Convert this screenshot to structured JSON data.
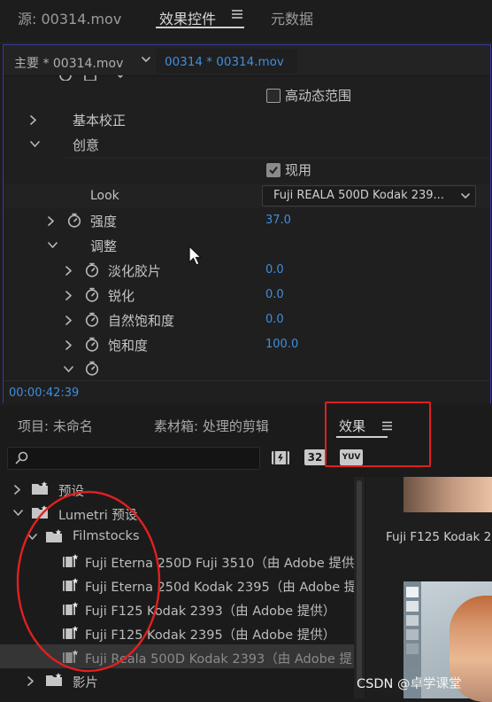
{
  "top_tabs": {
    "source": "源: 00314.mov",
    "effect_controls": "效果控件",
    "metadata": "元数据"
  },
  "sequence_tabs": {
    "master": "主要 * 00314.mov",
    "clip": "00314 * 00314.mov"
  },
  "effect_controls": {
    "hdr_label": "高动态范围",
    "basic_correction": "基本校正",
    "creative": "创意",
    "enable_label": "现用",
    "look_label": "Look",
    "look_value": "Fuji REALA 500D Kodak 239...",
    "intensity_label": "强度",
    "intensity_value": "37.0",
    "adjust_label": "调整",
    "params": [
      {
        "label": "淡化胶片",
        "value": "0.0"
      },
      {
        "label": "锐化",
        "value": "0.0"
      },
      {
        "label": "自然饱和度",
        "value": "0.0"
      },
      {
        "label": "饱和度",
        "value": "100.0"
      }
    ],
    "timecode": "00:00:42:39"
  },
  "bottom_tabs": {
    "project": "项目: 未命名",
    "bin": "素材箱: 处理的剪辑",
    "effects": "效果"
  },
  "toolbar": {
    "badge_32": "32",
    "badge_yuv": "YUV"
  },
  "effects_tree": {
    "presets": "预设",
    "lumetri": "Lumetri 预设",
    "filmstocks": "Filmstocks",
    "items": [
      "Fuji Eterna 250D Fuji 3510（由 Adobe 提供",
      "Fuji Eterna 250d Kodak 2395（由 Adobe 提",
      "Fuji F125 Kodak 2393（由 Adobe 提供）",
      "Fuji F125 Kodak 2395（由 Adobe 提供）",
      "Fuji Reala 500D Kodak 2393（由 Adobe 提"
    ],
    "cinematic": "影片"
  },
  "preview": {
    "title": "Fuji F125 Kodak 2"
  },
  "watermark": "CSDN @卓学课堂",
  "colors": {
    "accent_blue": "#3f8ee0",
    "annotation_red": "#e02020"
  }
}
